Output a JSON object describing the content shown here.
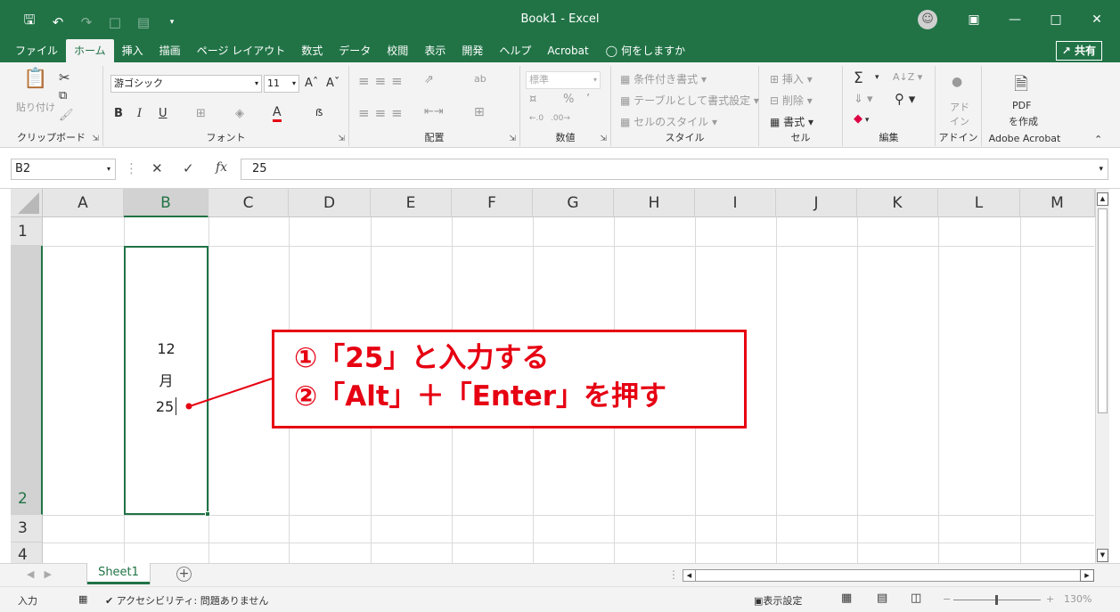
{
  "window": {
    "title": "Book1  -  Excel",
    "qat_icons": [
      "save-icon",
      "undo-icon",
      "redo-icon",
      "new-file-icon",
      "form-icon",
      "customize-qat-icon"
    ],
    "controls": [
      "ribbon-display-icon",
      "minimize-icon",
      "maximize-icon",
      "close-icon"
    ]
  },
  "tabs": [
    "ファイル",
    "ホーム",
    "挿入",
    "描画",
    "ページ レイアウト",
    "数式",
    "データ",
    "校閲",
    "表示",
    "開発",
    "ヘルプ",
    "Acrobat"
  ],
  "active_tab": "ホーム",
  "tell_me": "何をしますか",
  "share_label": "共有",
  "ribbon": {
    "clipboard": {
      "label": "クリップボード",
      "paste": "貼り付け"
    },
    "font": {
      "label": "フォント",
      "font_name": "游ゴシック",
      "font_size": "11",
      "bold": "B",
      "italic": "I",
      "underline": "U"
    },
    "alignment": {
      "label": "配置"
    },
    "number": {
      "label": "数値",
      "format": "標準",
      "percent": "%"
    },
    "styles": {
      "label": "スタイル",
      "conditional": "条件付き書式",
      "table": "テーブルとして書式設定",
      "cell_styles": "セルのスタイル"
    },
    "cells": {
      "label": "セル",
      "insert": "挿入",
      "delete": "削除",
      "format": "書式"
    },
    "editing": {
      "label": "編集"
    },
    "addins": {
      "label": "アドイン",
      "addin_line1": "アド",
      "addin_line2": "イン"
    },
    "acrobat": {
      "label": "Adobe Acrobat",
      "pdf_line1": "PDF",
      "pdf_line2": "を作成"
    }
  },
  "formula_bar": {
    "name_box": "B2",
    "value": "25",
    "fx": "fx"
  },
  "columns": [
    "A",
    "B",
    "C",
    "D",
    "E",
    "F",
    "G",
    "H",
    "I",
    "J",
    "K",
    "L",
    "M"
  ],
  "selected_column": "B",
  "rows": [
    "1",
    "2",
    "3",
    "4"
  ],
  "selected_row": "2",
  "cell_b2_lines": [
    "12",
    "月",
    "25"
  ],
  "annotation": {
    "line1": "①「25」と入力する",
    "line2": "②「Alt」＋「Enter」を押す",
    "color": "#e60012"
  },
  "sheets": [
    "Sheet1"
  ],
  "status": {
    "mode": "入力",
    "accessibility": "アクセシビリティ: 問題ありません",
    "display_settings": "表示設定",
    "zoom_minus": "−",
    "zoom_plus": "+",
    "zoom": "130%"
  },
  "colors": {
    "brand": "#217346",
    "annotation": "#e60012"
  }
}
